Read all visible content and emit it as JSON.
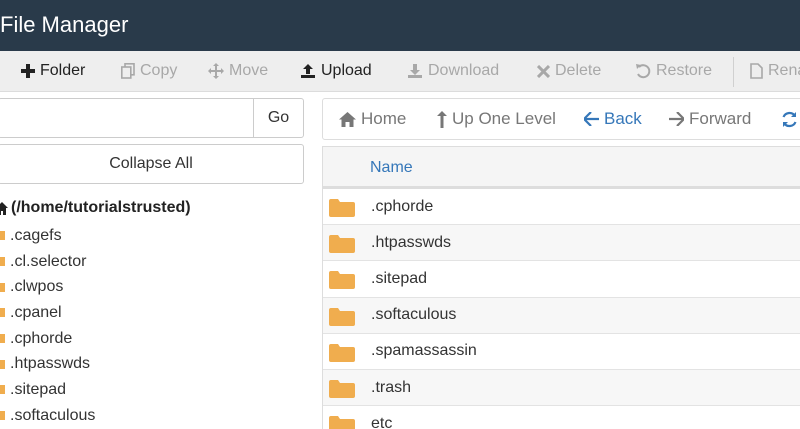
{
  "app": {
    "title": "File Manager"
  },
  "toolbar": {
    "items": [
      {
        "label": "Folder",
        "icon": "plus-icon",
        "enabled": true
      },
      {
        "label": "Copy",
        "icon": "copy-icon",
        "enabled": false
      },
      {
        "label": "Move",
        "icon": "move-icon",
        "enabled": false
      },
      {
        "label": "Upload",
        "icon": "upload-icon",
        "enabled": true
      },
      {
        "label": "Download",
        "icon": "download-icon",
        "enabled": false
      },
      {
        "label": "Delete",
        "icon": "close-icon",
        "enabled": false
      },
      {
        "label": "Restore",
        "icon": "undo-icon",
        "enabled": false
      },
      {
        "label": "Rena",
        "icon": "file-icon",
        "enabled": false
      }
    ]
  },
  "sidebar": {
    "search": {
      "value": "",
      "placeholder": ""
    },
    "go_label": "Go",
    "collapse_label": "Collapse All",
    "root_label": "(/home/tutorialstrusted)",
    "tree": [
      {
        "label": ".cagefs"
      },
      {
        "label": ".cl.selector"
      },
      {
        "label": ".clwpos"
      },
      {
        "label": ".cpanel"
      },
      {
        "label": ".cphorde"
      },
      {
        "label": ".htpasswds"
      },
      {
        "label": ".sitepad"
      },
      {
        "label": ".softaculous"
      }
    ]
  },
  "nav": {
    "home": "Home",
    "up": "Up One Level",
    "back": "Back",
    "forward": "Forward"
  },
  "files": {
    "column_name": "Name",
    "rows": [
      {
        "name": ".cphorde"
      },
      {
        "name": ".htpasswds"
      },
      {
        "name": ".sitepad"
      },
      {
        "name": ".softaculous"
      },
      {
        "name": ".spamassassin"
      },
      {
        "name": ".trash"
      },
      {
        "name": "etc"
      }
    ]
  },
  "colors": {
    "header_bg": "#293a4a",
    "folder": "#f0ad4e",
    "link_blue": "#3577b9",
    "toolbar_bg": "#eeeeee"
  }
}
